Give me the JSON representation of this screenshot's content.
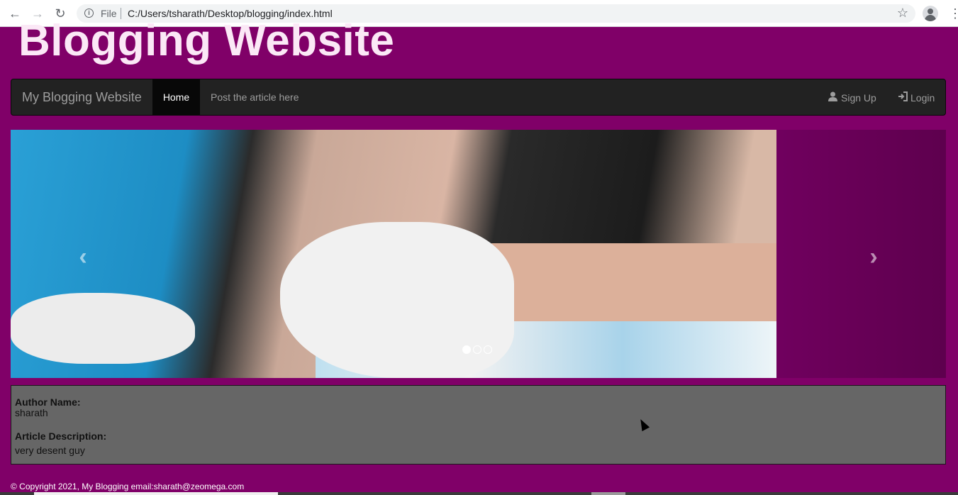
{
  "browser": {
    "scheme_label": "File",
    "url": "C:/Users/tsharath/Desktop/blogging/index.html",
    "back_icon": "←",
    "forward_icon": "→",
    "reload_icon": "↻",
    "info_icon": "i",
    "star_icon": "☆",
    "menu_icon": "⋮"
  },
  "page": {
    "title": "Blogging Website"
  },
  "navbar": {
    "brand": "My Blogging Website",
    "home": "Home",
    "post": "Post the article here",
    "signup": "Sign Up",
    "login": "Login"
  },
  "carousel": {
    "prev_icon": "‹",
    "next_icon": "›",
    "slide_count": 3,
    "active_slide": 1
  },
  "article": {
    "author_label": "Author Name:",
    "author_value": "sharath",
    "description_label": "Article Description:",
    "description_value": "very desent guy"
  },
  "footer": {
    "text": "© Copyright 2021, My Blogging email:sharath@zeomega.com"
  },
  "colors": {
    "page_background": "#800068",
    "navbar": "#222222",
    "article_box": "#666666"
  }
}
